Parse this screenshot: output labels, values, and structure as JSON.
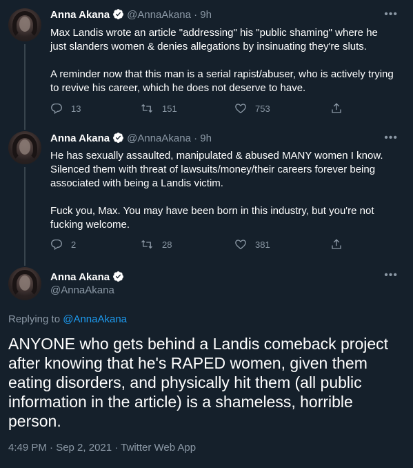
{
  "tweets": [
    {
      "name": "Anna Akana",
      "handle": "@AnnaAkana",
      "dot": "·",
      "time": "9h",
      "text": "Max Landis wrote an article \"addressing\" his \"public shaming\" where he\njust slanders women & denies allegations by insinuating they're sluts.\n\nA reminder now that this man is a serial rapist/abuser, who is actively trying\nto revive his career, which he does not deserve to have.",
      "replies": "13",
      "retweets": "151",
      "likes": "753"
    },
    {
      "name": "Anna Akana",
      "handle": "@AnnaAkana",
      "dot": "·",
      "time": "9h",
      "text": "He has sexually assaulted, manipulated & abused MANY women I know.\nSilenced them with threat of lawsuits/money/their careers forever being\nassociated with being a Landis victim.\n\nFuck you, Max. You may have been born in this industry, but you're not\nfucking welcome.",
      "replies": "2",
      "retweets": "28",
      "likes": "381"
    }
  ],
  "main_tweet": {
    "name": "Anna Akana",
    "handle": "@AnnaAkana",
    "replying_prefix": "Replying to",
    "replying_to": "@AnnaAkana",
    "text": "ANYONE who gets behind a Landis comeback project after knowing that he's RAPED women, given them eating disorders, and physically hit them (all public information in the article) is a shameless, horrible person.",
    "timestamp": "4:49 PM · Sep 2, 2021 · Twitter Web App"
  },
  "icons": {
    "more": "more-options-icon",
    "reply": "reply-icon",
    "retweet": "retweet-icon",
    "like": "like-icon",
    "share": "share-icon",
    "verified": "verified-badge-icon"
  },
  "colors": {
    "background": "#15202b",
    "secondary_text": "#8b98a5",
    "accent": "#1d9bf0",
    "divider": "#38444d"
  }
}
